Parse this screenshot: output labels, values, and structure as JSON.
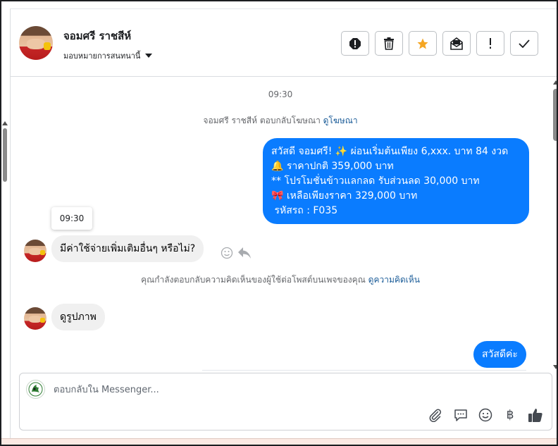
{
  "header": {
    "contact_name": "จอมศรี ราชสีห์",
    "assign_label": "มอบหมายการสนทนานี้",
    "buttons": [
      {
        "name": "report-spam",
        "icon": "exclamation-circle-icon"
      },
      {
        "name": "delete",
        "icon": "trash-icon"
      },
      {
        "name": "star",
        "icon": "star-icon",
        "color": "#f5a623"
      },
      {
        "name": "mark-unread",
        "icon": "envelope-icon"
      },
      {
        "name": "mark-important",
        "icon": "exclamation-icon"
      },
      {
        "name": "mark-done",
        "icon": "check-icon"
      }
    ]
  },
  "messages": {
    "timestamp_top": "09:30",
    "ad_reply_text": "จอมศรี ราชสีห์ ตอบกลับโฆษณา",
    "ad_reply_link": "ดูโฆษณา",
    "outgoing_1": {
      "lines": [
        "สวัสดี จอมศรี! ✨  ผ่อนเริ่มต้นเพียง 6,xxx. บาท 84 งวด",
        "🔔 ราคาปกติ  359,000 บาท",
        "** โปรโมชั่นข้าวแลกลด รับส่วนลด 30,000 บาท",
        "🎀  เหลือเพียงราคา 329,000 บาท",
        " รหัสรถ : F035"
      ]
    },
    "tooltip_time": "09:30",
    "incoming_1": "มีค่าใช้จ่ายเพิ่มเติมอื่นๆ หรือไม่?",
    "comment_reply_text": "คุณกำลังตอบกลับความคิดเห็นของผู้ใช้ต่อโพสต์บนเพจของคุณ",
    "comment_reply_link": "ดูความคิดเห็น",
    "incoming_2": "ดูรูปภาพ",
    "outgoing_2": "สวัสดีค่ะ"
  },
  "composer": {
    "placeholder": "ตอบกลับใน Messenger...",
    "tools": [
      "paperclip-icon",
      "chat-bubble-icon",
      "emoji-icon",
      "baht-icon",
      "thumbs-up-icon"
    ]
  },
  "colors": {
    "outgoing_bubble": "#0a7cff",
    "incoming_bubble": "#f0f0f0",
    "link": "#1b5c98",
    "star": "#f5a623"
  }
}
